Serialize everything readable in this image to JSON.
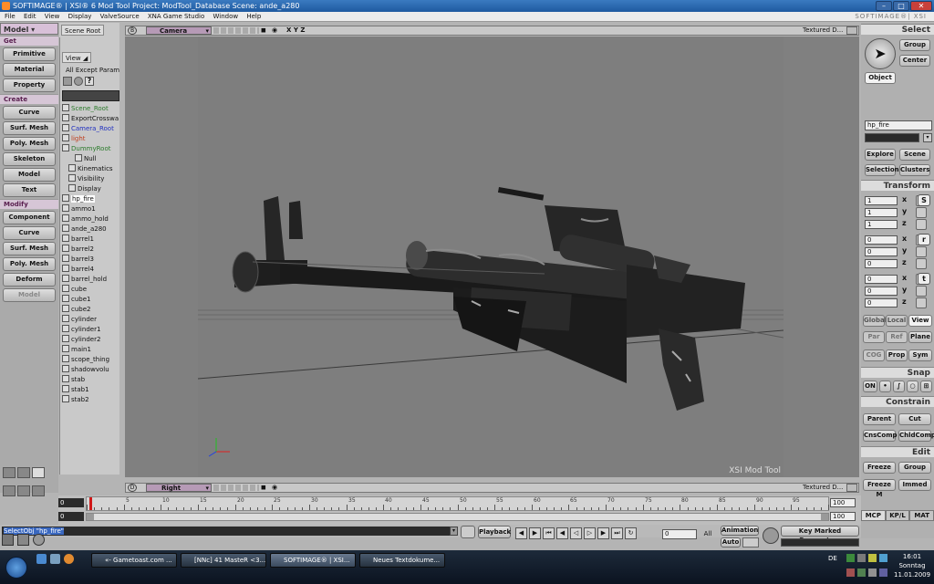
{
  "window": {
    "title": "SOFTIMAGE® | XSI® 6 Mod Tool Project: ModTool_Database    Scene: ande_a280",
    "brand": "SOFTIMAGE®| XSI"
  },
  "menu": [
    "File",
    "Edit",
    "View",
    "Display",
    "ValveSource",
    "XNA Game Studio",
    "Window",
    "Help"
  ],
  "left_panel": {
    "mode": "Model",
    "sections": [
      {
        "header": "Get",
        "buttons": [
          "Primitive",
          "Material",
          "Property"
        ]
      },
      {
        "header": "Create",
        "buttons": [
          "Curve",
          "Surf. Mesh",
          "Poly. Mesh",
          "Skeleton",
          "Model",
          "Text"
        ]
      },
      {
        "header": "Modify",
        "buttons": [
          "Component",
          "Curve",
          "Surf. Mesh",
          "Poly. Mesh",
          "Deform",
          "Model"
        ]
      }
    ]
  },
  "explorer": {
    "scope_tab": "Scene Root",
    "view_tab": "View",
    "filter": "All Except Params",
    "items": [
      {
        "label": "Scene_Root",
        "color": "#2a7a2a",
        "indent": 0
      },
      {
        "label": "ExportCrosswa",
        "color": "#111",
        "indent": 0
      },
      {
        "label": "Camera_Root",
        "color": "#2030c0",
        "indent": 0
      },
      {
        "label": "light",
        "color": "#c04020",
        "indent": 0
      },
      {
        "label": "DummyRoot",
        "color": "#2a7a2a",
        "indent": 0
      },
      {
        "label": "Null",
        "color": "#111",
        "indent": 2
      },
      {
        "label": "Kinematics",
        "color": "#111",
        "indent": 1
      },
      {
        "label": "Visibility",
        "color": "#111",
        "indent": 1
      },
      {
        "label": "Display",
        "color": "#111",
        "indent": 1
      },
      {
        "label": "hp_fire",
        "color": "#111",
        "indent": 0,
        "selected": true
      },
      {
        "label": "ammo1",
        "color": "#111",
        "indent": 0
      },
      {
        "label": "ammo_hold",
        "color": "#111",
        "indent": 0
      },
      {
        "label": "ande_a280",
        "color": "#111",
        "indent": 0
      },
      {
        "label": "barrel1",
        "color": "#111",
        "indent": 0
      },
      {
        "label": "barrel2",
        "color": "#111",
        "indent": 0
      },
      {
        "label": "barrel3",
        "color": "#111",
        "indent": 0
      },
      {
        "label": "barrel4",
        "color": "#111",
        "indent": 0
      },
      {
        "label": "barrel_hold",
        "color": "#111",
        "indent": 0
      },
      {
        "label": "cube",
        "color": "#111",
        "indent": 0
      },
      {
        "label": "cube1",
        "color": "#111",
        "indent": 0
      },
      {
        "label": "cube2",
        "color": "#111",
        "indent": 0
      },
      {
        "label": "cylinder",
        "color": "#111",
        "indent": 0
      },
      {
        "label": "cylinder1",
        "color": "#111",
        "indent": 0
      },
      {
        "label": "cylinder2",
        "color": "#111",
        "indent": 0
      },
      {
        "label": "main1",
        "color": "#111",
        "indent": 0
      },
      {
        "label": "scope_thing",
        "color": "#111",
        "indent": 0
      },
      {
        "label": "shadowvolu",
        "color": "#111",
        "indent": 0
      },
      {
        "label": "stab",
        "color": "#111",
        "indent": 0
      },
      {
        "label": "stab1",
        "color": "#111",
        "indent": 0
      },
      {
        "label": "stab2",
        "color": "#111",
        "indent": 0
      }
    ]
  },
  "viewport_top": {
    "letter": "B",
    "camera": "Camera",
    "axes": "X Y Z",
    "shading": "Textured D...",
    "watermark": "XSI Mod Tool"
  },
  "viewport_bottom": {
    "letter": "D",
    "camera": "Right",
    "shading": "Textured D..."
  },
  "timeline": {
    "start": "0",
    "end": "100",
    "current": "0",
    "end_field": "100",
    "range_end": "100",
    "ticks": [
      "5",
      "10",
      "15",
      "20",
      "25",
      "30",
      "35",
      "40",
      "45",
      "50",
      "55",
      "60",
      "65",
      "70",
      "75",
      "80",
      "85",
      "90",
      "95"
    ],
    "marker": "0"
  },
  "command": {
    "text": "SelectObj \"hp_fire\""
  },
  "playback": {
    "label": "Playback",
    "frame": "0",
    "all": "All",
    "animation": "Animation",
    "auto": "Auto",
    "key_marked": "Key Marked Parameters"
  },
  "right_panel": {
    "select_header": "Select",
    "group": "Group",
    "center": "Center",
    "object": "Object",
    "selected_name": "hp_fire",
    "explore": "Explore",
    "scene": "Scene",
    "selection": "Selection",
    "clusters": "Clusters",
    "transform_header": "Transform",
    "scale": [
      "1",
      "1",
      "1"
    ],
    "rotate": [
      "0",
      "0",
      "0"
    ],
    "translate": [
      "0",
      "0",
      "0"
    ],
    "axes": [
      "x",
      "y",
      "z"
    ],
    "s": "S",
    "r": "r",
    "t": "t",
    "global": "Global",
    "local": "Local",
    "view": "View",
    "par": "Par",
    "ref": "Ref",
    "plane": "Plane",
    "cog": "COG",
    "prop": "Prop",
    "sym": "Sym",
    "snap_header": "Snap",
    "on": "ON",
    "constrain_header": "Constrain",
    "parent": "Parent",
    "cut": "Cut",
    "cnscomp": "CnsComp",
    "childcomp": "ChldComp",
    "edit_header": "Edit",
    "freeze": "Freeze",
    "group2": "Group",
    "freezem": "Freeze M",
    "immed": "Immed",
    "tabs": [
      "MCP",
      "KP/L",
      "MAT"
    ]
  },
  "taskbar": {
    "tasks": [
      "«- Gametoast.com ...",
      "[NNc] 41 MasteR <3...",
      "SOFTIMAGE® | XSI...",
      "Neues Textdokume..."
    ],
    "lang": "DE",
    "time": "16:01",
    "day": "Sonntag",
    "date": "11.01.2009"
  },
  "colors": {
    "accent": "#d8c0d8",
    "title_bar": "#2c6cb4",
    "taskbar": "#141e2c"
  }
}
